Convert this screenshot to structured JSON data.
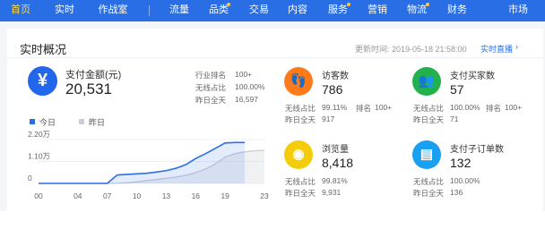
{
  "nav": {
    "items": [
      {
        "label": "首页",
        "active": true,
        "dot": false
      },
      {
        "label": "实时",
        "active": false,
        "dot": false
      },
      {
        "label": "作战室",
        "active": false,
        "dot": false
      },
      {
        "label": "流量",
        "active": false,
        "dot": false
      },
      {
        "label": "品类",
        "active": false,
        "dot": true
      },
      {
        "label": "交易",
        "active": false,
        "dot": false
      },
      {
        "label": "内容",
        "active": false,
        "dot": false
      },
      {
        "label": "服务",
        "active": false,
        "dot": true
      },
      {
        "label": "营销",
        "active": false,
        "dot": false
      },
      {
        "label": "物流",
        "active": false,
        "dot": true
      },
      {
        "label": "财务",
        "active": false,
        "dot": false
      },
      {
        "label": "市场",
        "active": false,
        "dot": false
      }
    ]
  },
  "overview": {
    "title": "实时概况",
    "update_label": "更新时间: 2019-05-18 21:58:00",
    "live_link": "实时直播",
    "live_chevron": "›"
  },
  "payment": {
    "icon": "yen-icon",
    "icon_glyph": "¥",
    "label": "支付金额(元)",
    "value": "20,531",
    "rank_label": "行业排名",
    "rank_value": "100+",
    "wireless_label": "无线占比",
    "wireless_value": "100.00%",
    "yesterday_label": "昨日全天",
    "yesterday_value": "16,597"
  },
  "visitors": {
    "icon": "footprint-icon",
    "icon_glyph": "👣",
    "label": "访客数",
    "value": "786",
    "wireless_label": "无线占比",
    "wireless_value": "99.11%",
    "rank_label": "排名",
    "rank_value": "100+",
    "yesterday_label": "昨日全天",
    "yesterday_value": "917"
  },
  "buyers": {
    "icon": "users-icon",
    "icon_glyph": "👥",
    "label": "支付买家数",
    "value": "57",
    "wireless_label": "无线占比",
    "wireless_value": "100.00%",
    "rank_label": "排名",
    "rank_value": "100+",
    "yesterday_label": "昨日全天",
    "yesterday_value": "71"
  },
  "pageviews": {
    "icon": "eye-icon",
    "icon_glyph": "◉",
    "label": "浏览量",
    "value": "8,418",
    "wireless_label": "无线占比",
    "wireless_value": "99.81%",
    "yesterday_label": "昨日全天",
    "yesterday_value": "9,931"
  },
  "suborders": {
    "icon": "clipboard-icon",
    "icon_glyph": "▤",
    "label": "支付子订单数",
    "value": "132",
    "wireless_label": "无线占比",
    "wireless_value": "100.00%",
    "yesterday_label": "昨日全天",
    "yesterday_value": "136"
  },
  "colors": {
    "nav_bg": "#2a6ee6",
    "today": "#2a6ee6",
    "yesterday": "#c8ccd4",
    "visitors_icon": "#ff7a1a",
    "buyers_icon": "#22b14c",
    "pageviews_icon": "#f5cc0a",
    "suborders_icon": "#1aa0f0"
  },
  "chart_data": {
    "type": "area",
    "legend": [
      "今日",
      "昨日"
    ],
    "x_ticks": [
      "00",
      "04",
      "07",
      "10",
      "13",
      "16",
      "19",
      "23"
    ],
    "y_ticks": [
      "0",
      "1.10万",
      "2.20万"
    ],
    "ylim": [
      0,
      22000
    ],
    "xlim": [
      0,
      23
    ],
    "series": [
      {
        "name": "今日",
        "x": [
          0,
          7,
          8,
          9,
          10,
          11,
          12,
          13,
          14,
          15,
          16,
          17,
          18,
          19,
          20,
          21
        ],
        "y": [
          0,
          0,
          4200,
          4500,
          4800,
          5100,
          5700,
          6400,
          7600,
          9400,
          12500,
          14900,
          17600,
          20300,
          20531,
          20531
        ]
      },
      {
        "name": "昨日",
        "x": [
          0,
          7,
          8,
          9,
          10,
          11,
          12,
          13,
          14,
          15,
          16,
          17,
          18,
          19,
          20,
          21,
          22,
          23
        ],
        "y": [
          0,
          0,
          100,
          300,
          800,
          1400,
          2000,
          2600,
          3200,
          4100,
          5400,
          7200,
          9800,
          13200,
          14900,
          15800,
          16400,
          16597
        ]
      }
    ]
  }
}
